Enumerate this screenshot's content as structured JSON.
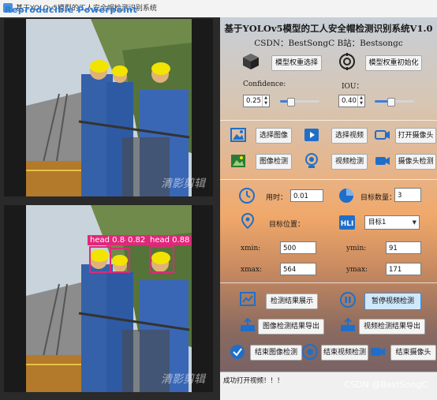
{
  "window": {
    "title": "基于YOLOv5模型的工人安全帽检测识别系统",
    "overlay_watermark": "Reproducible Powerpoint"
  },
  "video_top": {
    "watermark": "清影剪辑"
  },
  "video_bottom": {
    "watermark": "清影剪辑",
    "detections": [
      {
        "label": "head",
        "conf": "0.84"
      },
      {
        "label": "",
        "conf": "0.82"
      },
      {
        "label": "head",
        "conf": "0.88"
      }
    ]
  },
  "header": {
    "title": "基于YOLOv5模型的工人安全帽检测识别系统V1.0",
    "subtitle": "CSDN：BestSongC   B站：Bestsongc"
  },
  "model": {
    "select_label": "模型权重选择",
    "init_label": "模型权重初始化"
  },
  "params": {
    "confidence_label": "Confidence:",
    "confidence_value": "0.25",
    "confidence_level": 0.25,
    "iou_label": "IOU：",
    "iou_value": "0.40",
    "iou_level": 0.4
  },
  "actions": {
    "select_image": "选择图像",
    "select_video": "选择视频",
    "open_camera": "打开摄像头",
    "image_detect": "图像检测",
    "video_detect": "视频检测",
    "camera_detect": "摄像头检测"
  },
  "results": {
    "time_label": "用时：",
    "time_value": "0.01",
    "count_label": "目标数量：",
    "count_value": "3",
    "position_label": "目标位置：",
    "target_select": "目标1",
    "xmin_label": "xmin:",
    "xmin_value": "500",
    "ymin_label": "ymin:",
    "ymin_value": "91",
    "xmax_label": "xmax:",
    "xmax_value": "564",
    "ymax_label": "ymax:",
    "ymax_value": "171"
  },
  "controls": {
    "show_result": "检测结果展示",
    "pause_video": "暂停视频检测",
    "export_image": "图像检测结果导出",
    "export_video": "视频检测结果导出",
    "end_image": "结束图像检测",
    "end_video": "结束视频检测",
    "end_camera": "结束摄像头"
  },
  "status": {
    "message": "成功打开视频！！！",
    "csdn_watermark": "CSDN @BestSongC"
  },
  "colors": {
    "detection_box": "#e0287a",
    "accent": "#3c7ed8"
  }
}
